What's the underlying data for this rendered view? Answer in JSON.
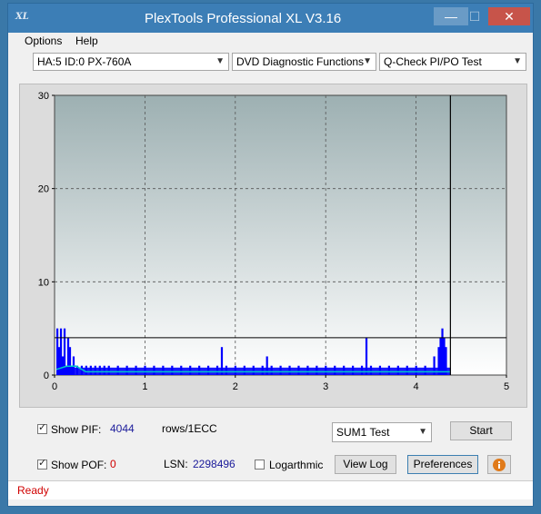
{
  "app": {
    "title": "PlexTools Professional XL V3.16",
    "logo_text": "XL"
  },
  "window_buttons": {
    "minimize": "—",
    "maximize": "☐",
    "close": "✕"
  },
  "menu": {
    "items": [
      "Options",
      "Help"
    ]
  },
  "toolbar": {
    "drive": "HA:5 ID:0  PX-760A",
    "function": "DVD Diagnostic Functions",
    "test": "Q-Check PI/PO Test"
  },
  "chart_data": {
    "type": "bar",
    "x_ticks": [
      "0",
      "1",
      "2",
      "3",
      "4",
      "5"
    ],
    "y_ticks": [
      "0",
      "10",
      "20",
      "30"
    ],
    "xlim": [
      0,
      5
    ],
    "ylim": [
      0,
      30
    ],
    "grid": true,
    "threshold_line": 4,
    "end_marker_x": 4.38,
    "colors": {
      "bars": "#0000ff",
      "trace": "#00c8c8",
      "bg_top": "#9db0b2",
      "bg_bottom": "#ffffff"
    },
    "series": [
      {
        "x": [
          0.03,
          0.05,
          0.07,
          0.09,
          0.11,
          0.13,
          0.15,
          0.17,
          0.19,
          0.21,
          0.25,
          0.3,
          0.35,
          0.4,
          0.45,
          0.5,
          0.55,
          0.6,
          0.7,
          0.8,
          0.9,
          1.0,
          1.1,
          1.2,
          1.3,
          1.4,
          1.5,
          1.6,
          1.7,
          1.8,
          1.85,
          1.9,
          2.0,
          2.1,
          2.2,
          2.3,
          2.35,
          2.4,
          2.5,
          2.6,
          2.7,
          2.8,
          2.9,
          3.0,
          3.1,
          3.2,
          3.3,
          3.4,
          3.45,
          3.5,
          3.6,
          3.7,
          3.8,
          3.9,
          4.0,
          4.1,
          4.2,
          4.25,
          4.27,
          4.29,
          4.31,
          4.33
        ],
        "values": [
          5,
          3,
          5,
          2,
          5,
          1,
          4,
          3,
          1,
          2,
          1,
          1,
          1,
          1,
          1,
          1,
          1,
          1,
          1,
          1,
          1,
          1,
          1,
          1,
          1,
          1,
          1,
          1,
          1,
          1,
          3,
          1,
          1,
          1,
          1,
          1,
          2,
          1,
          1,
          1,
          1,
          1,
          1,
          1,
          1,
          1,
          1,
          1,
          4,
          1,
          1,
          1,
          1,
          1,
          1,
          1,
          2,
          3,
          4,
          5,
          4,
          3
        ]
      }
    ]
  },
  "controls": {
    "show_pif_label": "Show PIF:",
    "pif_value": "4044",
    "rows_label": "rows/1ECC",
    "show_pof_label": "Show POF:",
    "pof_value": "0",
    "lsn_label": "LSN:",
    "lsn_value": "2298496",
    "log_label": "Logarthmic",
    "sum_select": "SUM1 Test",
    "start": "Start",
    "view_log": "View Log",
    "preferences": "Preferences"
  },
  "status": {
    "text": "Ready"
  }
}
